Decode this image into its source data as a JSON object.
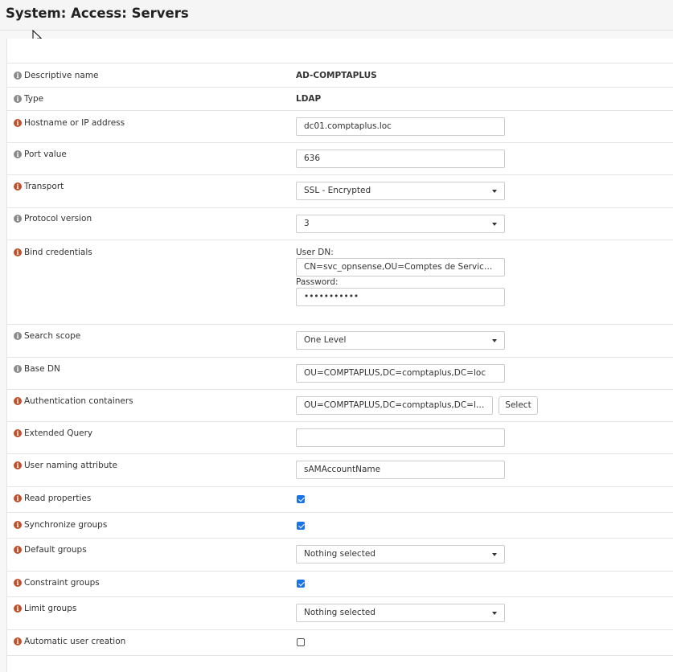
{
  "page": {
    "title": "System: Access: Servers"
  },
  "form": {
    "descriptive_name": {
      "label": "Descriptive name",
      "value": "AD-COMPTAPLUS"
    },
    "type": {
      "label": "Type",
      "value": "LDAP"
    },
    "hostname": {
      "label": "Hostname or IP address",
      "value": "dc01.comptaplus.loc"
    },
    "port": {
      "label": "Port value",
      "value": "636"
    },
    "transport": {
      "label": "Transport",
      "value": "SSL - Encrypted"
    },
    "protocol_version": {
      "label": "Protocol version",
      "value": "3"
    },
    "bind_credentials": {
      "label": "Bind credentials",
      "user_dn_label": "User DN:",
      "user_dn_value": "CN=svc_opnsense,OU=Comptes de Service,OU=...",
      "password_label": "Password:",
      "password_value": "•••••••••••"
    },
    "search_scope": {
      "label": "Search scope",
      "value": "One Level"
    },
    "base_dn": {
      "label": "Base DN",
      "value": "OU=COMPTAPLUS,DC=comptaplus,DC=loc"
    },
    "auth_containers": {
      "label": "Authentication containers",
      "value": "OU=COMPTAPLUS,DC=comptaplus,DC=loc",
      "button": "Select"
    },
    "extended_query": {
      "label": "Extended Query",
      "value": ""
    },
    "user_naming_attribute": {
      "label": "User naming attribute",
      "value": "sAMAccountName"
    },
    "read_properties": {
      "label": "Read properties",
      "checked": true
    },
    "synchronize_groups": {
      "label": "Synchronize groups",
      "checked": true
    },
    "default_groups": {
      "label": "Default groups",
      "value": "Nothing selected"
    },
    "constraint_groups": {
      "label": "Constraint groups",
      "checked": true
    },
    "limit_groups": {
      "label": "Limit groups",
      "value": "Nothing selected"
    },
    "automatic_user_creation": {
      "label": "Automatic user creation",
      "checked": false
    }
  },
  "colors": {
    "info_gray": "#8a8a8a",
    "info_red": "#c0502b",
    "checkbox_blue": "#1a73e8"
  }
}
